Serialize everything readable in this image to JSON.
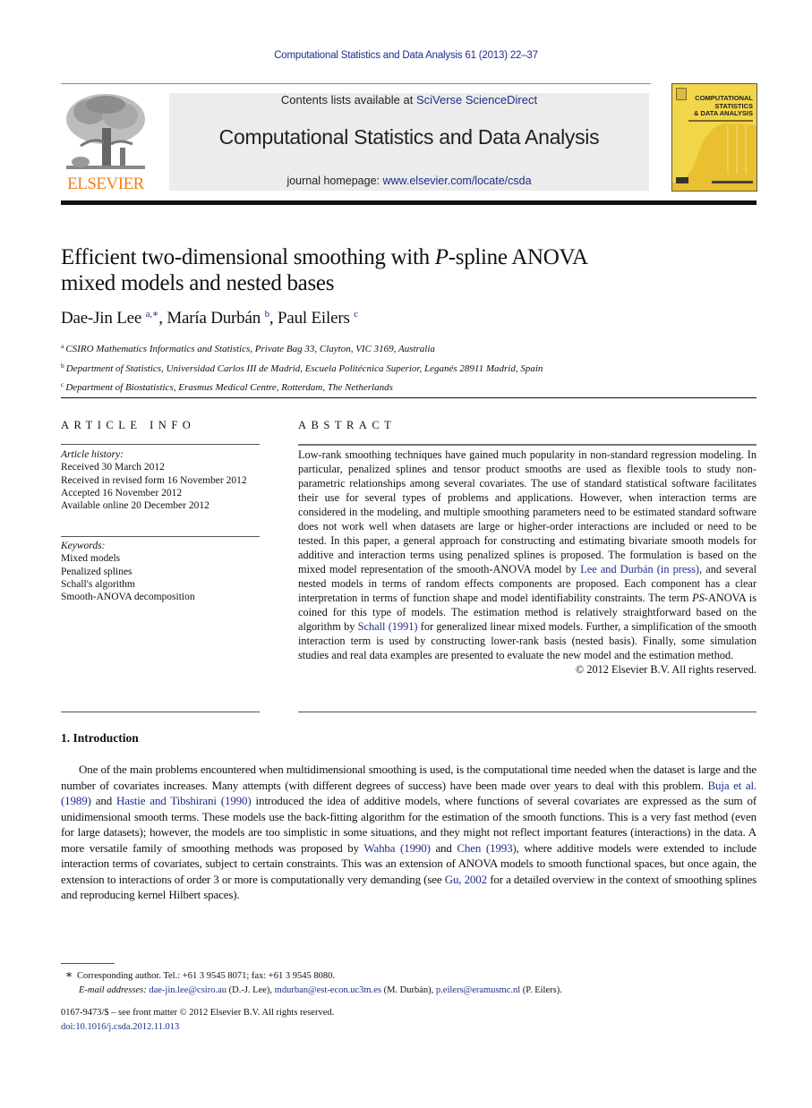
{
  "header": {
    "journal_reference": "Computational Statistics and Data Analysis 61 (2013) 22–37",
    "contents_prefix": "Contents lists available at ",
    "contents_link": "SciVerse ScienceDirect",
    "journal_title": "Computational Statistics and Data Analysis",
    "homepage_prefix": "journal homepage: ",
    "homepage_link": "www.elsevier.com/locate/csda",
    "publisher_logo_text": "ELSEVIER",
    "cover_title_lines": [
      "COMPUTATIONAL",
      "STATISTICS",
      "& DATA ANALYSIS"
    ],
    "colors": {
      "publisher_orange": "#f07f1a",
      "link_blue": "#1f2d8a",
      "cover_yellow": "#f2d64a",
      "masthead_gray": "#ececec"
    }
  },
  "article": {
    "title_part1": "Efficient two-dimensional smoothing with ",
    "title_italic": "P",
    "title_part2": "-spline ANOVA",
    "title_line2": "mixed models and nested bases",
    "authors": [
      {
        "name": "Dae-Jin Lee",
        "sup": "a,∗"
      },
      {
        "name": "María Durbán",
        "sup": "b"
      },
      {
        "name": "Paul Eilers",
        "sup": "c"
      }
    ],
    "author_separator": ", ",
    "affiliations": [
      {
        "mark": "a",
        "text": "CSIRO Mathematics Informatics and Statistics, Private Bag 33, Clayton, VIC 3169, Australia"
      },
      {
        "mark": "b",
        "text": "Department of Statistics, Universidad Carlos III de Madrid, Escuela Politécnica Superior, Leganés 28911 Madrid, Spain"
      },
      {
        "mark": "c",
        "text": "Department of Biostatistics, Erasmus Medical Centre, Rotterdam, The Netherlands"
      }
    ]
  },
  "article_info": {
    "heading": "ARTICLE INFO",
    "history_label": "Article history:",
    "history": [
      "Received 30 March 2012",
      "Received in revised form 16 November 2012",
      "Accepted 16 November 2012",
      "Available online 20 December 2012"
    ],
    "keywords_label": "Keywords:",
    "keywords": [
      "Mixed models",
      "Penalized splines",
      "Schall's algorithm",
      "Smooth-ANOVA decomposition"
    ]
  },
  "abstract": {
    "heading": "ABSTRACT",
    "text_1": "Low-rank smoothing techniques have gained much popularity in non-standard regression modeling. In particular, penalized splines and tensor product smooths are used as flexible tools to study non-parametric relationships among several covariates. The use of standard statistical software facilitates their use for several types of problems and applications. However, when interaction terms are considered in the modeling, and multiple smoothing parameters need to be estimated standard software does not work well when datasets are large or higher-order interactions are included or need to be tested. In this paper, a general approach for constructing and estimating bivariate smooth models for additive and interaction terms using penalized splines is proposed. The formulation is based on the mixed model representation of the smooth-ANOVA model by ",
    "cite_1": "Lee and Durbán (in press)",
    "text_2": ", and several nested models in terms of random effects components are proposed. Each component has a clear interpretation in terms of function shape and model identifiability constraints. The term ",
    "term_italic": "PS",
    "text_3": "-ANOVA is coined for this type of models. The estimation method is relatively straightforward based on the algorithm by ",
    "cite_2": "Schall (1991)",
    "text_4": " for generalized linear mixed models. Further, a simplification of the smooth interaction term is used by constructing lower-rank basis (nested basis). Finally, some simulation studies and real data examples are presented to evaluate the new model and the estimation method.",
    "copyright": "© 2012 Elsevier B.V. All rights reserved."
  },
  "introduction": {
    "heading": "1.  Introduction",
    "p1": "One of the main problems encountered when multidimensional smoothing is used, is the computational time needed when the dataset is large and the number of covariates increases. Many attempts (with different degrees of success) have been made over years to deal with this problem. ",
    "cite_buja": "Buja et al. (1989)",
    "p2": " and ",
    "cite_hastie": "Hastie and Tibshirani (1990)",
    "p3": " introduced the idea of additive models, where functions of several covariates are expressed as the sum of unidimensional smooth terms. These models use the back-fitting algorithm for the estimation of the smooth functions. This is a very fast method (even for large datasets); however, the models are too simplistic in some situations, and they might not reflect important features (interactions) in the data. A more versatile family of smoothing methods was proposed by ",
    "cite_wahba": "Wahba (1990)",
    "p4": " and ",
    "cite_chen": "Chen (1993)",
    "p5": ", where additive models were extended to include interaction terms of covariates, subject to certain constraints. This was an extension of ANOVA models to smooth functional spaces, but once again, the extension to interactions of order 3 or more is computationally very demanding (see ",
    "cite_gu": "Gu, 2002",
    "p6": " for a detailed overview in the context of smoothing splines and reproducing kernel Hilbert spaces)."
  },
  "footnote": {
    "star": "∗",
    "corresponding": "Corresponding author. Tel.: +61 3 9545 8071; fax: +61 3 9545 8080.",
    "email_label": "E-mail addresses:",
    "emails": [
      {
        "address": "dae-jin.lee@csiro.au",
        "owner": " (D.-J. Lee), "
      },
      {
        "address": "mdurban@est-econ.uc3m.es",
        "owner": " (M. Durbán), "
      },
      {
        "address": "p.eilers@eramusmc.nl",
        "owner": " (P. Eilers)."
      }
    ]
  },
  "bottom": {
    "issn_line": "0167-9473/$ – see front matter © 2012 Elsevier B.V. All rights reserved.",
    "doi": "doi:10.1016/j.csda.2012.11.013"
  }
}
